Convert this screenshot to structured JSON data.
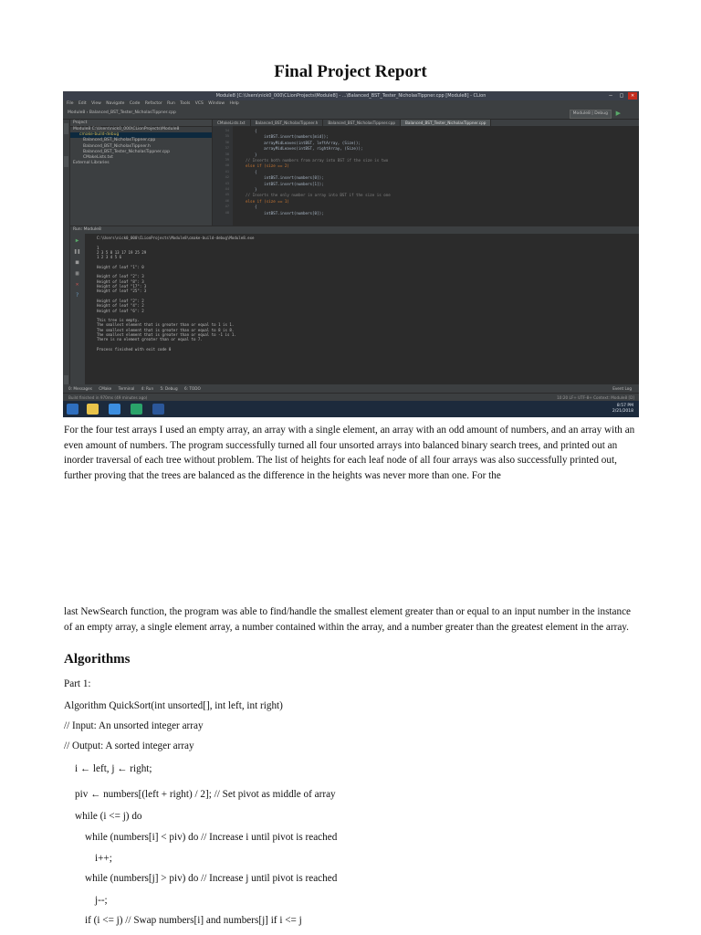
{
  "document": {
    "title": "Final Project Report",
    "paragraph1": "For the four test arrays I used an empty array, an array with a single element, an array with an odd amount of numbers, and an array with an even amount of numbers. The program successfully turned all four unsorted arrays into balanced binary search trees, and printed out an inorder traversal of each tree without problem. The list of heights for each leaf node of all four arrays was also successfully printed out, further proving that the trees are balanced as the difference in the heights was never more than one. For the",
    "paragraph2": "last NewSearch function, the program was able to find/handle the smallest element greater than or equal to an input number in the instance of an empty array, a single element array, a number contained within the array, and a number greater than the greatest element in the array.",
    "heading_algorithms": "Algorithms",
    "part": "Part 1:",
    "algorithm_lines": [
      "Algorithm QuickSort(int unsorted[], int left, int right)",
      "// Input: An unsorted integer array",
      "// Output: A sorted integer array",
      "i ← left, j ← right;",
      "piv ← numbers[(left + right) / 2]; // Set pivot as middle of array",
      "while (i <= j) do",
      "while (numbers[i] < piv) do // Increase i until pivot is reached",
      "i++;",
      "while (numbers[j] > piv) do // Increase j until pivot is reached",
      "j--;",
      "if (i <= j) // Swap numbers[i] and numbers[j] if i <= j"
    ]
  },
  "screenshot": {
    "window_title": "Module8 [C:\\Users\\nick0_000\\CLionProjects\\Module8] - ...\\Balanced_BST_Tester_NicholasTippner.cpp [Module8] - CLion",
    "menu": [
      "File",
      "Edit",
      "View",
      "Navigate",
      "Code",
      "Refactor",
      "Run",
      "Tools",
      "VCS",
      "Window",
      "Help"
    ],
    "breadcrumb": "Module8  ›  Balanced_BST_Tester_NicholasTippner.cpp",
    "run_config": "Module8 | Debug",
    "project_header": "Project",
    "project_tree": [
      "Module8  C:\\Users\\nick0_000\\CLionProjects\\Module8",
      "cmake-build-debug",
      "Balanced_BST_NicholasTippner.cpp",
      "Balanced_BST_NicholasTippner.h",
      "Balanced_BST_Tester_NicholasTippner.cpp",
      "CMakeLists.txt",
      "External Libraries"
    ],
    "tabs": [
      "CMakeLists.txt",
      "Balanced_BST_NicholasTippner.h",
      "Balanced_BST_NicholasTippner.cpp",
      "Balanced_BST_Tester_NicholasTippner.cpp"
    ],
    "code_lines": [
      "{",
      "    intBST.insert(numbers[mid]);",
      "    arrayMidLeaves(intBST, leftArray, (Size));",
      "    arrayMidLeaves(intBST, rightArray, (Size));",
      "}",
      "// Inserts both numbers from array into BST if the size is two",
      "else if (size == 2)",
      "{",
      "    intBST.insert(numbers[0]);",
      "    intBST.insert(numbers[1]);",
      "}",
      "// Inserts the only number in array into BST if the size is one",
      "else if (size == 1)",
      "{",
      "    intBST.insert(numbers[0]);"
    ],
    "line_numbers": [
      "34",
      "35",
      "36",
      "37",
      "38",
      "39",
      "40",
      "41",
      "42",
      "43",
      "44",
      "45",
      "46",
      "47",
      "48"
    ],
    "run_label": "Run:  Module8",
    "console_lines": [
      "C:\\Users\\nick0_000\\CLionProjects\\Module8\\cmake-build-debug\\Module8.exe",
      "",
      "1",
      "2 3 5 8 13 17 19 25 29",
      "1 2 3 4 5 6",
      "",
      "Height of leaf \"1\": 0",
      "",
      "Height of leaf \"2\": 3",
      "Height of leaf \"8\": 3",
      "Height of leaf \"17\": 3",
      "Height of leaf \"25\": 3",
      "",
      "Height of leaf \"2\": 2",
      "Height of leaf \"4\": 2",
      "Height of leaf \"6\": 2",
      "",
      "This tree is empty.",
      "The smallest element that is greater than or equal to 1 is 1.",
      "The smallest element that is greater than or equal to 8 is 8.",
      "The smallest element that is greater than or equal to -1 is 1.",
      "There is no element greater than or equal to 7.",
      "",
      "Process finished with exit code 0"
    ],
    "toolwindows": [
      "0: Messages",
      "CMake",
      "Terminal",
      "4: Run",
      "5: Debug",
      "6: TODO"
    ],
    "event_log": "Event Log",
    "status_left": "Build finished in 970ms (49 minutes ago)",
    "status_right": "10:20   LF÷   UTF-8÷   Context: Module8 [D]",
    "clock_time": "8:57 PM",
    "clock_date": "2/21/2018"
  }
}
